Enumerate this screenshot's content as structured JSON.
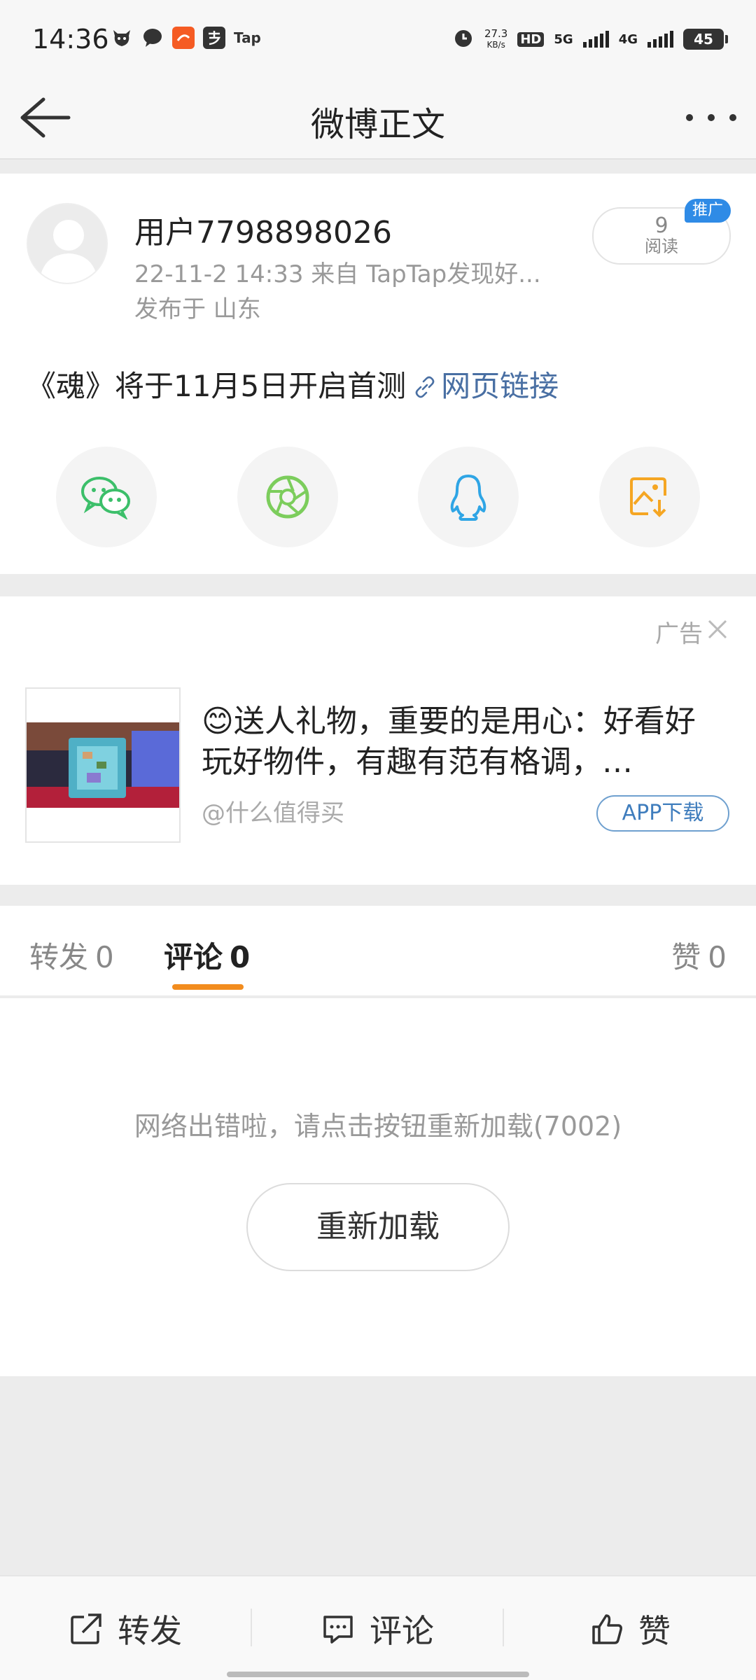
{
  "status_bar": {
    "time": "14:36",
    "net_speed_value": "27.3",
    "net_speed_unit": "KB/s",
    "hd_label": "HD",
    "signal_1_label": "5G",
    "signal_2_label": "4G",
    "battery": "45",
    "app_icons": [
      "cow-icon",
      "message-icon",
      "taobao-icon",
      "alipay-icon",
      "taptap-icon"
    ],
    "taptap_label": "Tap"
  },
  "nav": {
    "title": "微博正文"
  },
  "post": {
    "username": "用户7798898026",
    "meta": "22-11-2 14:33  来自 TapTap发现好...",
    "location": "发布于 山东",
    "read_count": "9",
    "read_label": "阅读",
    "promo_badge": "推广",
    "text": "《魂》将于11月5日开启首测",
    "link_text": "网页链接",
    "share_targets": [
      "wechat-icon",
      "moments-icon",
      "qq-icon",
      "save-image-icon"
    ]
  },
  "ad": {
    "label": "广告",
    "title": "😊送人礼物，重要的是用心：好看好玩好物件，有趣有范有格调，…",
    "source": "@什么值得买",
    "app_button": "APP下载"
  },
  "tabs": {
    "repost_label": "转发",
    "repost_count": "0",
    "comment_label": "评论",
    "comment_count": "0",
    "like_label": "赞",
    "like_count": "0"
  },
  "content": {
    "error_message": "网络出错啦，请点击按钮重新加载(7002)",
    "reload_button": "重新加载"
  },
  "bottom_bar": {
    "repost": "转发",
    "comment": "评论",
    "like": "赞"
  },
  "colors": {
    "accent": "#f28c1e",
    "link": "#496fa3",
    "badge": "#2f8be6",
    "wechat": "#3cbf6a",
    "moments": "#7ccd5c",
    "qq": "#2fa5e5",
    "save": "#f5a623"
  }
}
